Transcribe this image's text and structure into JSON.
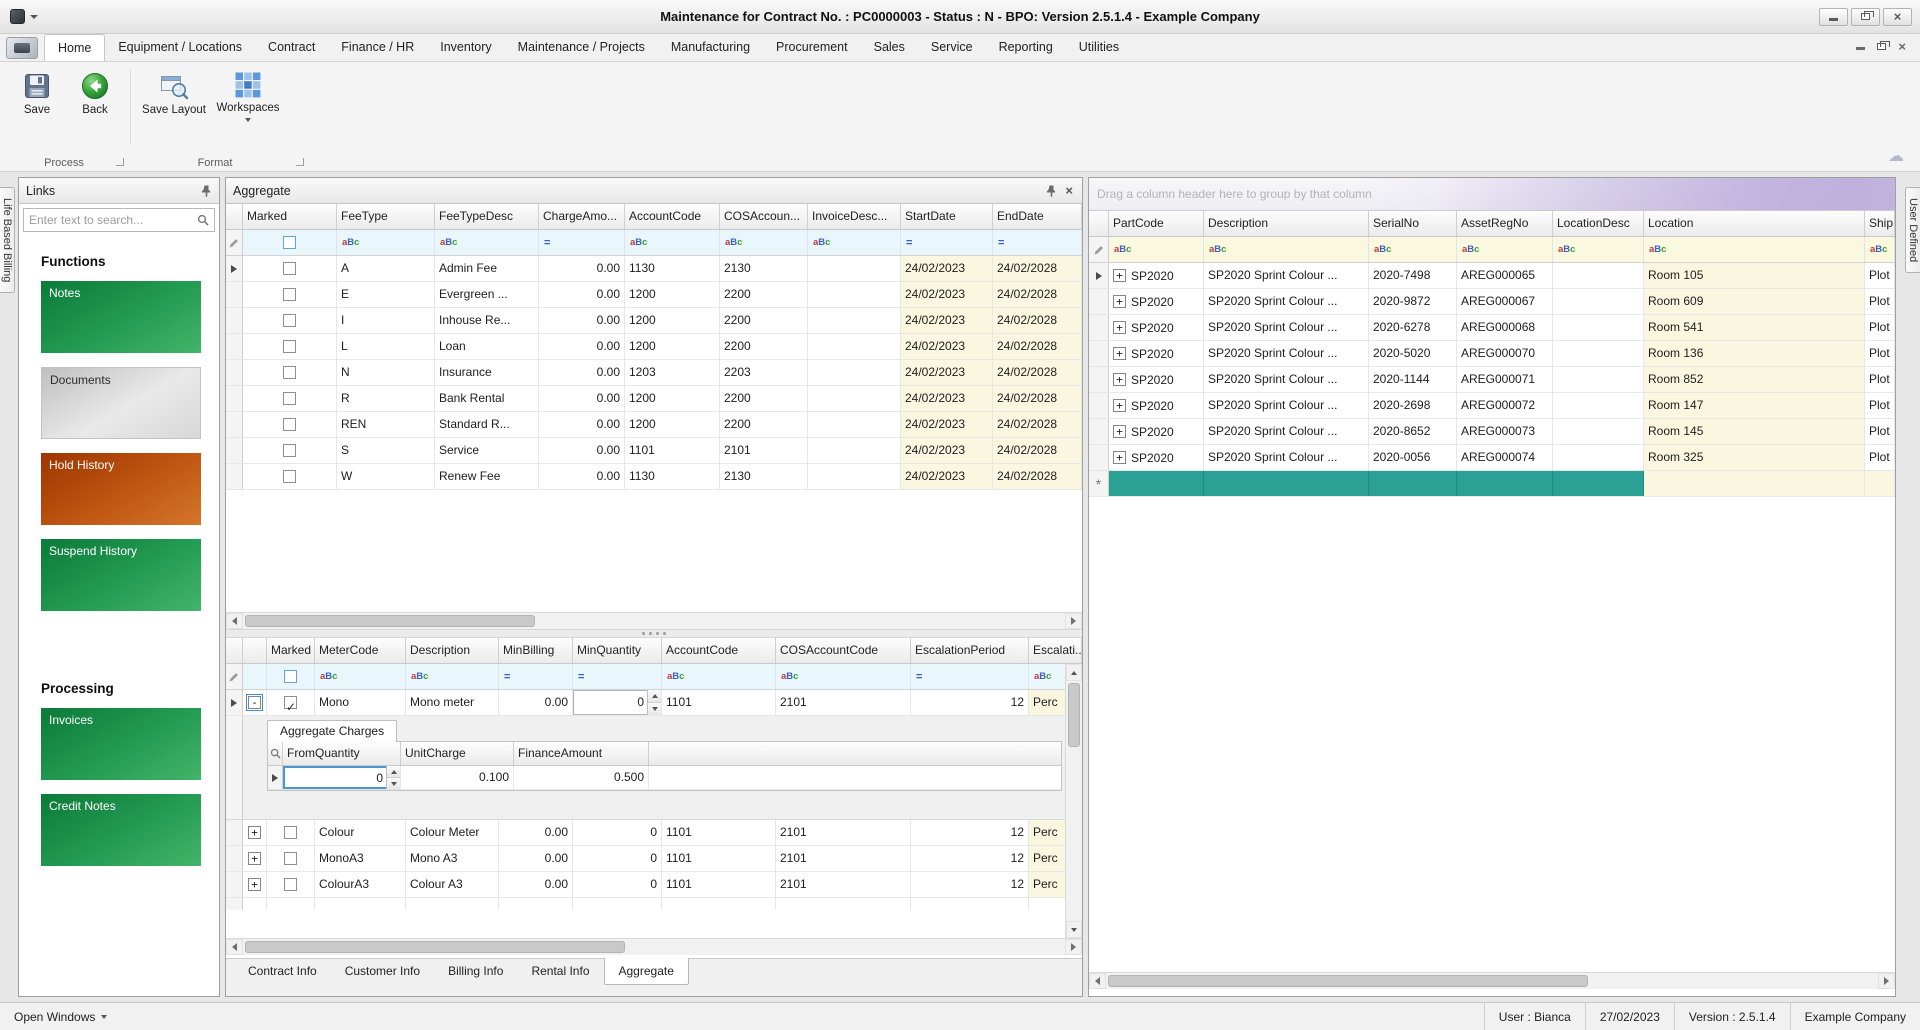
{
  "window": {
    "title": "Maintenance for Contract No. : PC0000003 - Status : N - BPO: Version 2.5.1.4 - Example Company"
  },
  "menu": {
    "tabs": [
      "Home",
      "Equipment / Locations",
      "Contract",
      "Finance / HR",
      "Inventory",
      "Maintenance / Projects",
      "Manufacturing",
      "Procurement",
      "Sales",
      "Service",
      "Reporting",
      "Utilities"
    ],
    "selected": "Home"
  },
  "ribbon": {
    "save": "Save",
    "back": "Back",
    "save_layout": "Save Layout",
    "workspaces": "Workspaces",
    "group_process": "Process",
    "group_format": "Format"
  },
  "side_tabs": {
    "left": "Life Based Billing",
    "right": "User Defined"
  },
  "links": {
    "title": "Links",
    "search_placeholder": "Enter text to search...",
    "functions_heading": "Functions",
    "processing_heading": "Processing",
    "notes": "Notes",
    "documents": "Documents",
    "hold_history": "Hold History",
    "suspend_history": "Suspend History",
    "invoices": "Invoices",
    "credit_notes": "Credit Notes"
  },
  "aggregate": {
    "title": "Aggregate",
    "fee_grid": {
      "headers": [
        "Marked",
        "FeeType",
        "FeeTypeDesc",
        "ChargeAmo...",
        "AccountCode",
        "COSAccoun...",
        "InvoiceDesc...",
        "StartDate",
        "EndDate"
      ],
      "rows": [
        {
          "fee_type": "A",
          "desc": "Admin Fee",
          "charge": "0.00",
          "account": "1130",
          "cos": "2130",
          "start": "24/02/2023",
          "end": "24/02/2028"
        },
        {
          "fee_type": "E",
          "desc": "Evergreen ...",
          "charge": "0.00",
          "account": "1200",
          "cos": "2200",
          "start": "24/02/2023",
          "end": "24/02/2028"
        },
        {
          "fee_type": "I",
          "desc": "Inhouse Re...",
          "charge": "0.00",
          "account": "1200",
          "cos": "2200",
          "start": "24/02/2023",
          "end": "24/02/2028"
        },
        {
          "fee_type": "L",
          "desc": "Loan",
          "charge": "0.00",
          "account": "1200",
          "cos": "2200",
          "start": "24/02/2023",
          "end": "24/02/2028"
        },
        {
          "fee_type": "N",
          "desc": "Insurance",
          "charge": "0.00",
          "account": "1203",
          "cos": "2203",
          "start": "24/02/2023",
          "end": "24/02/2028"
        },
        {
          "fee_type": "R",
          "desc": "Bank Rental",
          "charge": "0.00",
          "account": "1200",
          "cos": "2200",
          "start": "24/02/2023",
          "end": "24/02/2028"
        },
        {
          "fee_type": "REN",
          "desc": "Standard R...",
          "charge": "0.00",
          "account": "1200",
          "cos": "2200",
          "start": "24/02/2023",
          "end": "24/02/2028"
        },
        {
          "fee_type": "S",
          "desc": "Service",
          "charge": "0.00",
          "account": "1101",
          "cos": "2101",
          "start": "24/02/2023",
          "end": "24/02/2028"
        },
        {
          "fee_type": "W",
          "desc": "Renew Fee",
          "charge": "0.00",
          "account": "1130",
          "cos": "2130",
          "start": "24/02/2023",
          "end": "24/02/2028"
        }
      ]
    },
    "meter_grid": {
      "headers": [
        "Marked",
        "MeterCode",
        "Description",
        "MinBilling",
        "MinQuantity",
        "AccountCode",
        "COSAccountCode",
        "EscalationPeriod",
        "Escalati..."
      ],
      "rows": [
        {
          "meter": "Mono",
          "desc": "Mono meter",
          "minb": "0.00",
          "minq": "0",
          "acct": "1101",
          "cos": "2101",
          "escp": "12",
          "esc": "Perc"
        },
        {
          "meter": "Colour",
          "desc": "Colour Meter",
          "minb": "0.00",
          "minq": "0",
          "acct": "1101",
          "cos": "2101",
          "escp": "12",
          "esc": "Perc"
        },
        {
          "meter": "MonoA3",
          "desc": "Mono A3",
          "minb": "0.00",
          "minq": "0",
          "acct": "1101",
          "cos": "2101",
          "escp": "12",
          "esc": "Perc"
        },
        {
          "meter": "ColourA3",
          "desc": "Colour A3",
          "minb": "0.00",
          "minq": "0",
          "acct": "1101",
          "cos": "2101",
          "escp": "12",
          "esc": "Perc"
        }
      ]
    },
    "detail": {
      "tab": "Aggregate Charges",
      "headers": [
        "FromQuantity",
        "UnitCharge",
        "FinanceAmount"
      ],
      "row": {
        "fromq": "0",
        "unit": "0.100",
        "fin": "0.500"
      }
    },
    "tabs": [
      "Contract Info",
      "Customer Info",
      "Billing Info",
      "Rental Info",
      "Aggregate"
    ],
    "selected_tab": "Aggregate"
  },
  "equipment": {
    "groupby_hint": "Drag a column header here to group by that column",
    "headers": [
      "PartCode",
      "Description",
      "SerialNo",
      "AssetRegNo",
      "LocationDesc",
      "Location",
      "Ship..."
    ],
    "rows": [
      {
        "part": "SP2020",
        "desc": "SP2020 Sprint Colour ...",
        "serial": "2020-7498",
        "asset": "AREG000065",
        "location": "Room 105",
        "ship": "Plot"
      },
      {
        "part": "SP2020",
        "desc": "SP2020 Sprint Colour ...",
        "serial": "2020-9872",
        "asset": "AREG000067",
        "location": "Room 609",
        "ship": "Plot"
      },
      {
        "part": "SP2020",
        "desc": "SP2020 Sprint Colour ...",
        "serial": "2020-6278",
        "asset": "AREG000068",
        "location": "Room 541",
        "ship": "Plot"
      },
      {
        "part": "SP2020",
        "desc": "SP2020 Sprint Colour ...",
        "serial": "2020-5020",
        "asset": "AREG000070",
        "location": "Room 136",
        "ship": "Plot"
      },
      {
        "part": "SP2020",
        "desc": "SP2020 Sprint Colour ...",
        "serial": "2020-1144",
        "asset": "AREG000071",
        "location": "Room 852",
        "ship": "Plot"
      },
      {
        "part": "SP2020",
        "desc": "SP2020 Sprint Colour ...",
        "serial": "2020-2698",
        "asset": "AREG000072",
        "location": "Room 147",
        "ship": "Plot"
      },
      {
        "part": "SP2020",
        "desc": "SP2020 Sprint Colour ...",
        "serial": "2020-8652",
        "asset": "AREG000073",
        "location": "Room 145",
        "ship": "Plot"
      },
      {
        "part": "SP2020",
        "desc": "SP2020 Sprint Colour ...",
        "serial": "2020-0056",
        "asset": "AREG000074",
        "location": "Room 325",
        "ship": "Plot"
      }
    ]
  },
  "status": {
    "open_windows": "Open Windows",
    "user": "User : Bianca",
    "date": "27/02/2023",
    "version": "Version : 2.5.1.4",
    "company": "Example Company"
  },
  "colors": {
    "button_green": "#0c7a39",
    "button_orange": "#9e3500",
    "button_silver": "#d9d9d9",
    "new_row_teal": "#2ba195",
    "cream_cell": "#fbf6df",
    "filter_row_cyan": "#e9f6fb",
    "filter_row_yellow": "#fbf8e0"
  }
}
